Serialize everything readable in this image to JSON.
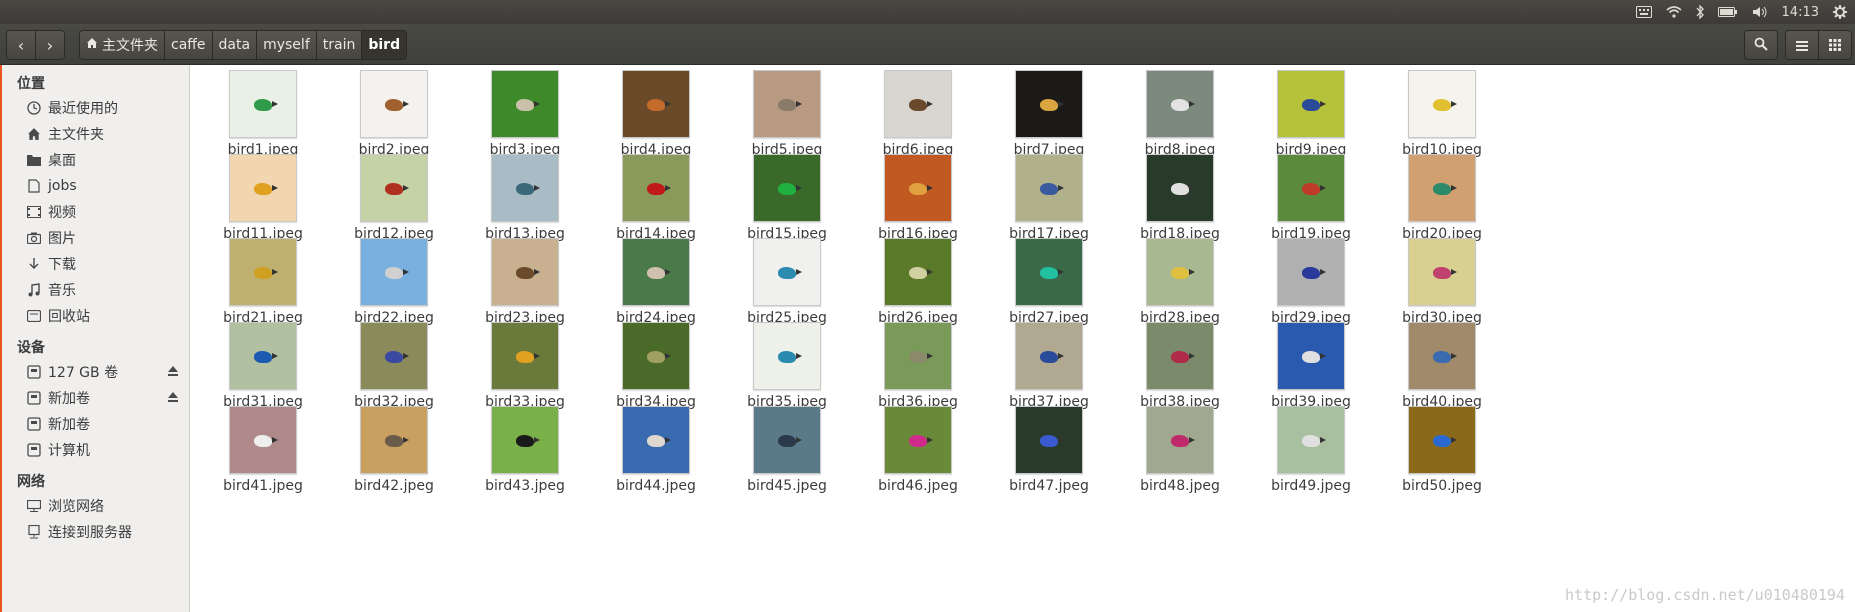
{
  "tray": {
    "clock": "14:13"
  },
  "nav": {
    "back": "‹",
    "forward": "›"
  },
  "breadcrumb": [
    "主文件夹",
    "caffe",
    "data",
    "myself",
    "train",
    "bird"
  ],
  "sidebar": {
    "places_title": "位置",
    "places": [
      {
        "label": "最近使用的",
        "icon": "clock-icon"
      },
      {
        "label": "主文件夹",
        "icon": "home-icon"
      },
      {
        "label": "桌面",
        "icon": "folder-icon"
      },
      {
        "label": "jobs",
        "icon": "file-icon"
      },
      {
        "label": "视频",
        "icon": "video-icon"
      },
      {
        "label": "图片",
        "icon": "camera-icon"
      },
      {
        "label": "下载",
        "icon": "download-icon"
      },
      {
        "label": "音乐",
        "icon": "music-icon"
      },
      {
        "label": "回收站",
        "icon": "trash-icon"
      }
    ],
    "devices_title": "设备",
    "devices": [
      {
        "label": "127 GB 卷",
        "icon": "drive-icon",
        "eject": true
      },
      {
        "label": "新加卷",
        "icon": "drive-icon",
        "eject": true
      },
      {
        "label": "新加卷",
        "icon": "drive-icon",
        "eject": false
      },
      {
        "label": "计算机",
        "icon": "drive-icon",
        "eject": false
      }
    ],
    "network_title": "网络",
    "network": [
      {
        "label": "浏览网络",
        "icon": "network-icon"
      },
      {
        "label": "连接到服务器",
        "icon": "server-icon"
      }
    ]
  },
  "files": [
    {
      "name": "bird1.jpeg",
      "bg": "#e9f0e6",
      "bird": "#2f9a4a"
    },
    {
      "name": "bird2.jpeg",
      "bg": "#f4f2ee",
      "bird": "#a0612e"
    },
    {
      "name": "bird3.jpeg",
      "bg": "#3e8a2a",
      "bird": "#c8c0a8"
    },
    {
      "name": "bird4.jpeg",
      "bg": "#6b4a2a",
      "bird": "#c46a2a"
    },
    {
      "name": "bird5.jpeg",
      "bg": "#b89a82",
      "bird": "#8a7a6a"
    },
    {
      "name": "bird6.jpeg",
      "bg": "#d9d6d2",
      "bird": "#6a4a2a"
    },
    {
      "name": "bird7.jpeg",
      "bg": "#1c1a18",
      "bird": "#d9a640"
    },
    {
      "name": "bird8.jpeg",
      "bg": "#7c8a7e",
      "bird": "#e2e2e2"
    },
    {
      "name": "bird9.jpeg",
      "bg": "#b6c23a",
      "bird": "#2a4a9a"
    },
    {
      "name": "bird10.jpeg",
      "bg": "#f5f3ee",
      "bird": "#e0c030"
    },
    {
      "name": "bird11.jpeg",
      "bg": "#f2d6b0",
      "bird": "#e0a020"
    },
    {
      "name": "bird12.jpeg",
      "bg": "#c4d2a6",
      "bird": "#b03020"
    },
    {
      "name": "bird13.jpeg",
      "bg": "#a9bcc6",
      "bird": "#3a6a7a"
    },
    {
      "name": "bird14.jpeg",
      "bg": "#8a9a5a",
      "bird": "#c01a1a"
    },
    {
      "name": "bird15.jpeg",
      "bg": "#3a6a2a",
      "bird": "#20b040"
    },
    {
      "name": "bird16.jpeg",
      "bg": "#c05a20",
      "bird": "#e0a040"
    },
    {
      "name": "bird17.jpeg",
      "bg": "#b0b08a",
      "bird": "#3a5aa0"
    },
    {
      "name": "bird18.jpeg",
      "bg": "#2a3a2a",
      "bird": "#e0e0e0"
    },
    {
      "name": "bird19.jpeg",
      "bg": "#5a8a3a",
      "bird": "#c03a2a"
    },
    {
      "name": "bird20.jpeg",
      "bg": "#d0a070",
      "bird": "#2a8a6a"
    },
    {
      "name": "bird21.jpeg",
      "bg": "#c0b070",
      "bird": "#d0a020"
    },
    {
      "name": "bird22.jpeg",
      "bg": "#7ab0e0",
      "bird": "#d0d0d0"
    },
    {
      "name": "bird23.jpeg",
      "bg": "#c8b090",
      "bird": "#6a4a2a"
    },
    {
      "name": "bird24.jpeg",
      "bg": "#4a7a4a",
      "bird": "#d0c0b0"
    },
    {
      "name": "bird25.jpeg",
      "bg": "#f0f0ee",
      "bird": "#2a8ab0"
    },
    {
      "name": "bird26.jpeg",
      "bg": "#5a7a2a",
      "bird": "#d0d0a0"
    },
    {
      "name": "bird27.jpeg",
      "bg": "#3a6a4a",
      "bird": "#20c0a0"
    },
    {
      "name": "bird28.jpeg",
      "bg": "#a8b890",
      "bird": "#e0c040"
    },
    {
      "name": "bird29.jpeg",
      "bg": "#b0b0b0",
      "bird": "#2a3a9a"
    },
    {
      "name": "bird30.jpeg",
      "bg": "#d8d090",
      "bird": "#c04070"
    },
    {
      "name": "bird31.jpeg",
      "bg": "#b0c0a0",
      "bird": "#1a5ab0"
    },
    {
      "name": "bird32.jpeg",
      "bg": "#8a8a5a",
      "bird": "#3a4aa0"
    },
    {
      "name": "bird33.jpeg",
      "bg": "#6a7a3a",
      "bird": "#e0a020"
    },
    {
      "name": "bird34.jpeg",
      "bg": "#4a6a2a",
      "bird": "#a0a060"
    },
    {
      "name": "bird35.jpeg",
      "bg": "#eef0ea",
      "bird": "#2a8ab0"
    },
    {
      "name": "bird36.jpeg",
      "bg": "#7a9a5a",
      "bird": "#8a8a6a"
    },
    {
      "name": "bird37.jpeg",
      "bg": "#b0a890",
      "bird": "#2a4a9a"
    },
    {
      "name": "bird38.jpeg",
      "bg": "#7a8a6a",
      "bird": "#b02a4a"
    },
    {
      "name": "bird39.jpeg",
      "bg": "#2a5ab0",
      "bird": "#e0e0e0"
    },
    {
      "name": "bird40.jpeg",
      "bg": "#a08a6a",
      "bird": "#3a6ab0"
    },
    {
      "name": "bird41.jpeg",
      "bg": "#b08a8a",
      "bird": "#eeeeee"
    },
    {
      "name": "bird42.jpeg",
      "bg": "#c8a060",
      "bird": "#6a5a4a"
    },
    {
      "name": "bird43.jpeg",
      "bg": "#7ab04a",
      "bird": "#1a1a1a"
    },
    {
      "name": "bird44.jpeg",
      "bg": "#3a6ab0",
      "bird": "#e0d8d0"
    },
    {
      "name": "bird45.jpeg",
      "bg": "#5a7a8a",
      "bird": "#2a3a4a"
    },
    {
      "name": "bird46.jpeg",
      "bg": "#6a8a3a",
      "bird": "#d02a8a"
    },
    {
      "name": "bird47.jpeg",
      "bg": "#2a3a2a",
      "bird": "#3a5ad0"
    },
    {
      "name": "bird48.jpeg",
      "bg": "#a0a890",
      "bird": "#c02a6a"
    },
    {
      "name": "bird49.jpeg",
      "bg": "#a8c0a0",
      "bird": "#e0e0e0"
    },
    {
      "name": "bird50.jpeg",
      "bg": "#8a6a1a",
      "bird": "#2a6ad0"
    }
  ],
  "watermark": "http://blog.csdn.net/u010480194"
}
